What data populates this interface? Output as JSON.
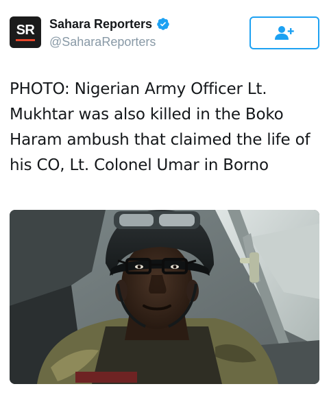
{
  "author": {
    "avatar_text": "SR",
    "display_name": "Sahara Reporters",
    "handle": "@SaharaReporters",
    "verified": true
  },
  "follow_button": {
    "icon": "add-user-icon"
  },
  "tweet": {
    "text": "PHOTO: Nigerian Army Officer Lt. Mukhtar was also killed in the Boko Haram ambush that claimed the life of his CO, Lt. Colonel Umar in Borno"
  },
  "media": {
    "kind": "photo"
  },
  "colors": {
    "accent": "#1da1f2",
    "text": "#14171a",
    "secondary_text": "#8899a6",
    "brand_bar": "#e8462a"
  }
}
